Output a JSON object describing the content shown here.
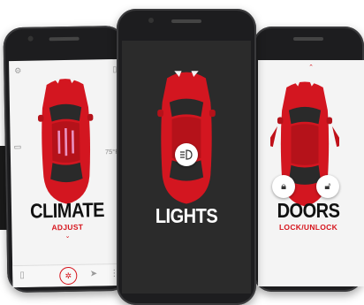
{
  "screens": {
    "climate": {
      "title": "CLIMATE",
      "action": "ADJUST",
      "temp": "75°F",
      "icons": [
        "settings-icon",
        "rear-defrost-icon",
        "phone-icon",
        "fan-icon",
        "navigation-icon"
      ]
    },
    "lights": {
      "title": "LIGHTS",
      "icons": [
        "headlight-icon"
      ]
    },
    "doors": {
      "title": "DOORS",
      "action": "LOCK/UNLOCK",
      "icons": [
        "lock-icon",
        "unlock-icon",
        "chevron-up-icon"
      ]
    }
  },
  "colors": {
    "accent": "#d6141c",
    "car_body": "#d31620",
    "phone_frame": "#1d1d1f",
    "dark_screen": "#2b2b2b"
  }
}
